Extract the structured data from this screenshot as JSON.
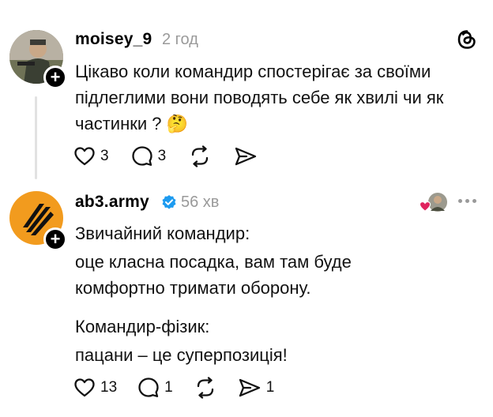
{
  "post1": {
    "username": "moisey_9",
    "time": "2 год",
    "text_lines": [
      "Цікаво коли командир спостерігає за своїми",
      "підлеглими вони поводять себе як хвилі чи як",
      "частинки ? 🤔"
    ],
    "likes": "3",
    "replies": "3"
  },
  "post2": {
    "username": "ab3.army",
    "time": "56 хв",
    "text_lines": [
      "Звичайний командир:",
      "оце класна посадка, вам там буде",
      "комфортно тримати оборону.",
      "Командир-фізик:",
      "пацани – це суперпозиція!"
    ],
    "likes": "13",
    "replies": "1",
    "shares": "1"
  },
  "icons": {
    "threads": "threads-logo-icon",
    "verified": "verified-badge-icon",
    "more": "more-dots-icon",
    "heart": "heart-icon",
    "comment": "comment-icon",
    "repost": "repost-icon",
    "share": "share-icon"
  },
  "colors": {
    "verified": "#1d9bf0",
    "ab3_avatar_bg": "#f29b1e",
    "liked_heart": "#e0245e"
  }
}
